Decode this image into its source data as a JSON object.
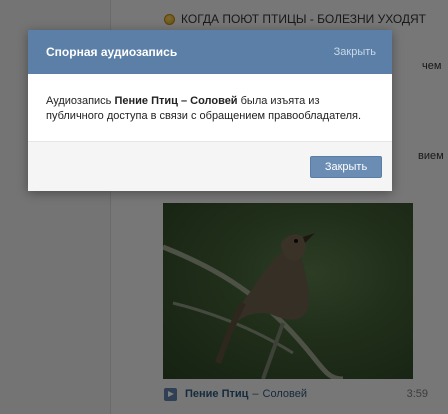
{
  "feed": {
    "post_title": "КОГДА ПОЮТ ПТИЦЫ - БОЛЕЗНИ УХОДЯТ",
    "fragment_1": "чем",
    "fragment_2": "вием"
  },
  "audio": {
    "artist": "Пение Птиц",
    "separator": "–",
    "song": "Соловей",
    "duration": "3:59"
  },
  "modal": {
    "title": "Спорная аудиозапись",
    "close_link": "Закрыть",
    "message_prefix": "Аудиозапись ",
    "message_track": "Пение Птиц – Соловей",
    "message_suffix": " была изъята из публичного доступа в связи с обращением правообладателя.",
    "button_label": "Закрыть"
  },
  "colors": {
    "modal_header": "#5b7fa6",
    "button": "#6b8db4",
    "link": "#2b587a"
  }
}
